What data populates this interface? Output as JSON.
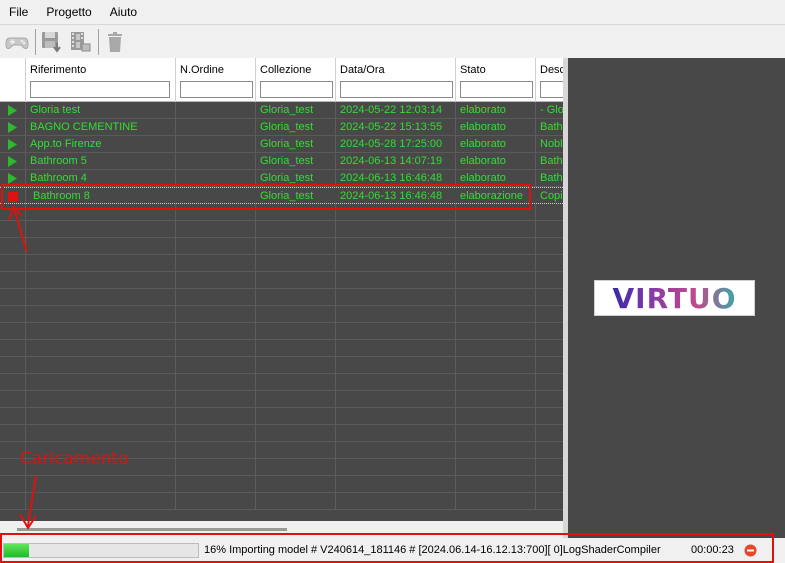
{
  "menu": [
    "File",
    "Progetto",
    "Aiuto"
  ],
  "toolbar": {
    "icons": [
      "gamepad-icon",
      "save-download-icon",
      "film-export-icon",
      "trash-icon"
    ]
  },
  "grid": {
    "columns": [
      {
        "key": "riferimento",
        "label": "Riferimento"
      },
      {
        "key": "nordine",
        "label": "N.Ordine"
      },
      {
        "key": "collezione",
        "label": "Collezione"
      },
      {
        "key": "dataora",
        "label": "Data/Ora"
      },
      {
        "key": "stato",
        "label": "Stato"
      },
      {
        "key": "desc",
        "label": "Desc"
      }
    ],
    "rows": [
      {
        "status": "play",
        "riferimento": "Gloria test",
        "nordine": "",
        "collezione": "Gloria_test",
        "dataora": "2024-05-22 12:03:14",
        "stato": "elaborato",
        "desc": "- Glo"
      },
      {
        "status": "play",
        "riferimento": "BAGNO CEMENTINE",
        "nordine": "",
        "collezione": "Gloria_test",
        "dataora": "2024-05-22 15:13:55",
        "stato": "elaborato",
        "desc": "Bath"
      },
      {
        "status": "play",
        "riferimento": "App.to Firenze",
        "nordine": "",
        "collezione": "Gloria_test",
        "dataora": "2024-05-28 17:25:00",
        "stato": "elaborato",
        "desc": "Nobl"
      },
      {
        "status": "play",
        "riferimento": "Bathroom 5",
        "nordine": "",
        "collezione": "Gloria_test",
        "dataora": "2024-06-13 14:07:19",
        "stato": "elaborato",
        "desc": "Bath"
      },
      {
        "status": "play",
        "riferimento": "Bathroom 4",
        "nordine": "",
        "collezione": "Gloria_test",
        "dataora": "2024-06-13 16:46:48",
        "stato": "elaborato",
        "desc": "Bath"
      },
      {
        "status": "stop",
        "riferimento": "Bathroom 8",
        "nordine": "",
        "collezione": "Gloria_test",
        "dataora": "2024-06-13 16:46:48",
        "stato": "elaborazione",
        "desc": "Copi"
      }
    ],
    "empty_rows": 18
  },
  "brand": {
    "logo_text": "VIRTUO"
  },
  "status": {
    "progress": 0.13,
    "message": "16% Importing model # V240614_181146 # [2024.06.14-16.12.13:700][  0]LogShaderCompiler",
    "elapsed": "00:00:23"
  },
  "annotation": {
    "label": "Caricamento",
    "color": "#e01010"
  },
  "colors": {
    "row_text": "#33dd33",
    "grid_bg": "#484848",
    "play": "#2db82d",
    "stop": "#e01010"
  }
}
